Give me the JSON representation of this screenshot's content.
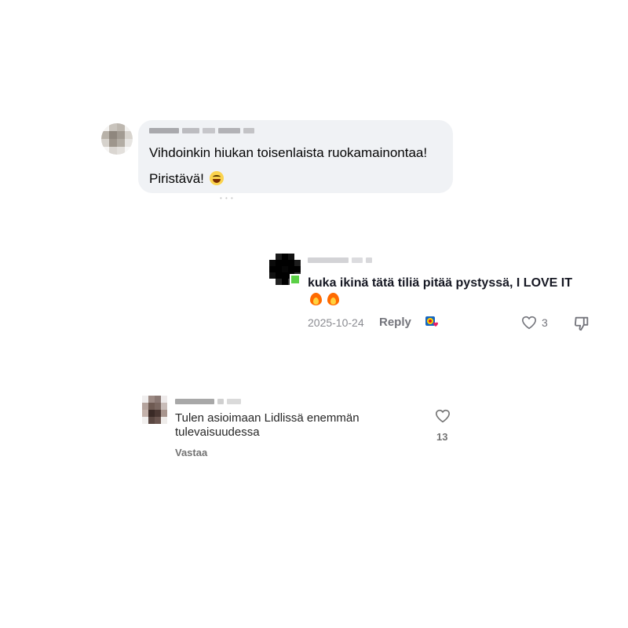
{
  "comment1": {
    "author": "",
    "line1": "Vihdoinkin hiukan toisenlaista ruokamainontaa!",
    "line2": "Piristävä!",
    "emoji_icon": "grinning-squinting-face-icon"
  },
  "comment2": {
    "author": "",
    "text": "kuka ikinä tätä tiliä pitää pystyssä, I LOVE IT",
    "emoji_icon": "fire-icon",
    "date": "2025-10-24",
    "reply_label": "Reply",
    "like_count": "3",
    "sticker_icon": "lidl-heart-sticker-icon"
  },
  "comment3": {
    "author": "",
    "text": "Tulen asioimaan Lidlissä enemmän tulevaisuudessa",
    "reply_label": "Vastaa",
    "like_count": "13"
  },
  "colors": {
    "fb_bubble": "#f0f2f5",
    "tiktok_text": "#161823",
    "muted": "#737373",
    "online_dot": "#5bd046"
  }
}
